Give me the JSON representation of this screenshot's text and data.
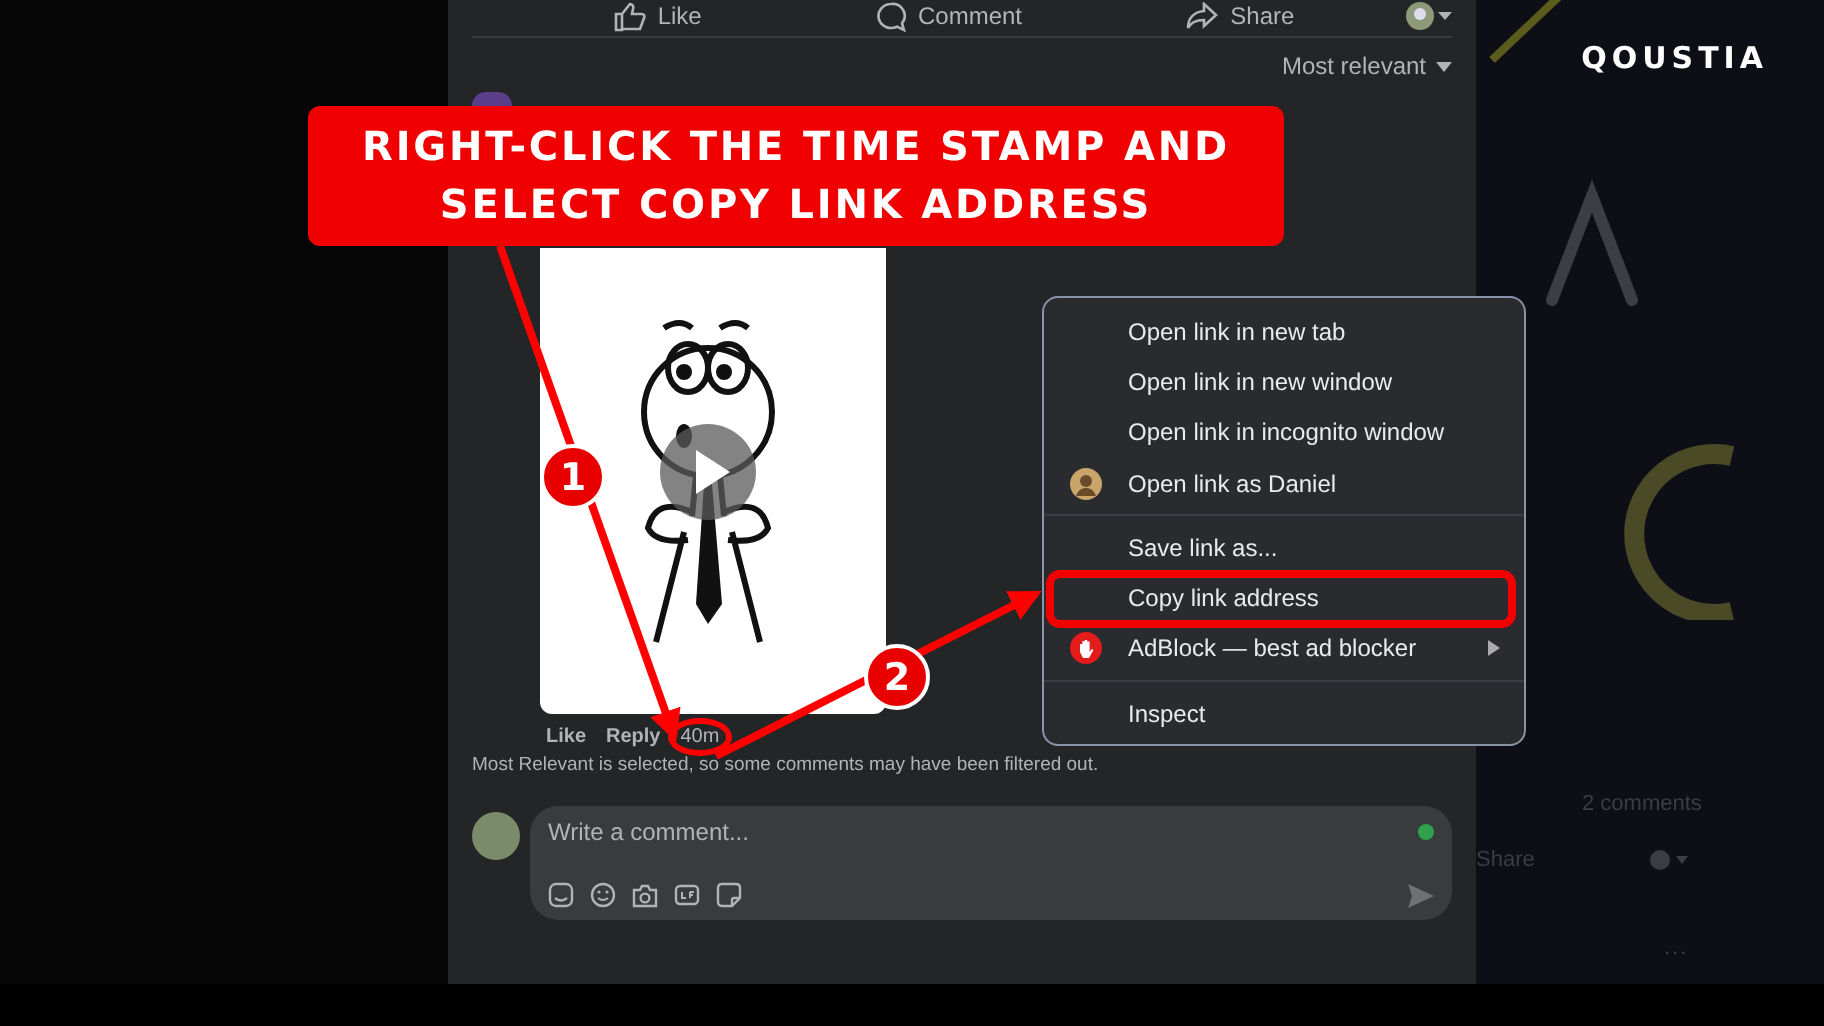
{
  "post_actions": [
    {
      "kind": "like",
      "label": "Like"
    },
    {
      "kind": "comment",
      "label": "Comment"
    },
    {
      "kind": "share",
      "label": "Share"
    }
  ],
  "sort": {
    "label": "Most relevant"
  },
  "comment": {
    "actions": [
      "Like",
      "Reply"
    ],
    "time": "40m",
    "time_circled": true
  },
  "filter_note": "Most Relevant is selected, so some comments may have been filtered out.",
  "composer": {
    "placeholder": "Write a comment...",
    "online": true
  },
  "context_menu": {
    "sections": [
      [
        {
          "kind": "plain",
          "label": "Open link in new tab",
          "highlighted": false,
          "submenu": false
        },
        {
          "kind": "plain",
          "label": "Open link in new window",
          "highlighted": false,
          "submenu": false
        },
        {
          "kind": "plain",
          "label": "Open link in incognito window",
          "highlighted": false,
          "submenu": false
        },
        {
          "kind": "profile",
          "label": "Open link as Daniel",
          "highlighted": false,
          "submenu": false
        }
      ],
      [
        {
          "kind": "plain",
          "label": "Save link as...",
          "highlighted": false,
          "submenu": false
        },
        {
          "kind": "plain",
          "label": "Copy link address",
          "highlighted": true,
          "submenu": false
        },
        {
          "kind": "extension",
          "label": "AdBlock — best ad blocker",
          "highlighted": false,
          "submenu": true
        }
      ],
      [
        {
          "kind": "plain",
          "label": "Inspect",
          "highlighted": false,
          "submenu": false
        }
      ]
    ]
  },
  "callout": {
    "text": "RIGHT-CLICK THE TIME STAMP AND\nSELECT COPY LINK ADDRESS"
  },
  "steps": [
    "1",
    "2"
  ],
  "logo": "QOUSTIA",
  "background_post": {
    "comments_count": "2 comments",
    "share": "Share",
    "more": "..."
  }
}
